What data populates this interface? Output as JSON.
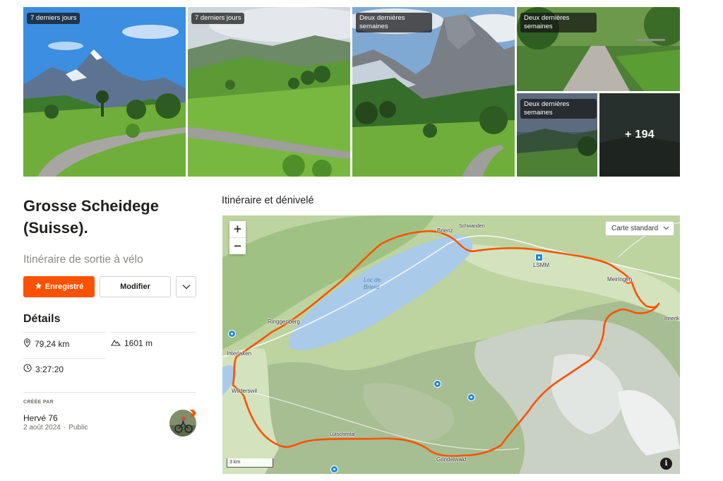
{
  "gallery": {
    "photos": [
      {
        "tag": "7 derniers jours"
      },
      {
        "tag": "7 derniers jours"
      },
      {
        "tag": "Deux dernières semaines"
      },
      {
        "tag": "Deux dernières semaines"
      },
      {
        "tag": "Deux dernières semaines"
      }
    ],
    "more_count": "+ 194"
  },
  "route": {
    "title": "Grosse Scheidege (Suisse).",
    "subtitle": "Itinéraire de sortie à vélo",
    "save_label": "Enregistré",
    "edit_label": "Modifier",
    "details_heading": "Détails",
    "distance": "79,24 km",
    "elevation": "1601 m",
    "duration": "3:27:20",
    "created_by_label": "CRÉÉE PAR",
    "author": "Hervé 76",
    "date": "2 août 2024",
    "visibility": "Public",
    "separator": "·"
  },
  "map": {
    "heading": "Itinéraire et dénivelé",
    "zoom_in": "+",
    "zoom_out": "−",
    "style_label": "Carte standard",
    "scale_label": "3 km",
    "info_label": "i",
    "lake_label_1": "Loc de",
    "lake_label_2": "Brienz",
    "places": {
      "brienz": "Brienz",
      "schwanden": "Schwanden",
      "lsmm": "LSMM",
      "meiringen": "Meiringen",
      "innert": "Innertk",
      "ringgenberg": "Ringgenberg",
      "interlaken": "Interlaken",
      "wilderswil": "Wilderswil",
      "lutschental": "Lütschental",
      "grindelwald": "Grindelwald"
    }
  },
  "colors": {
    "accent": "#fc5200",
    "route_line": "#fc5200",
    "lake": "#a9cbe9",
    "poi": "#1f8ad6"
  }
}
